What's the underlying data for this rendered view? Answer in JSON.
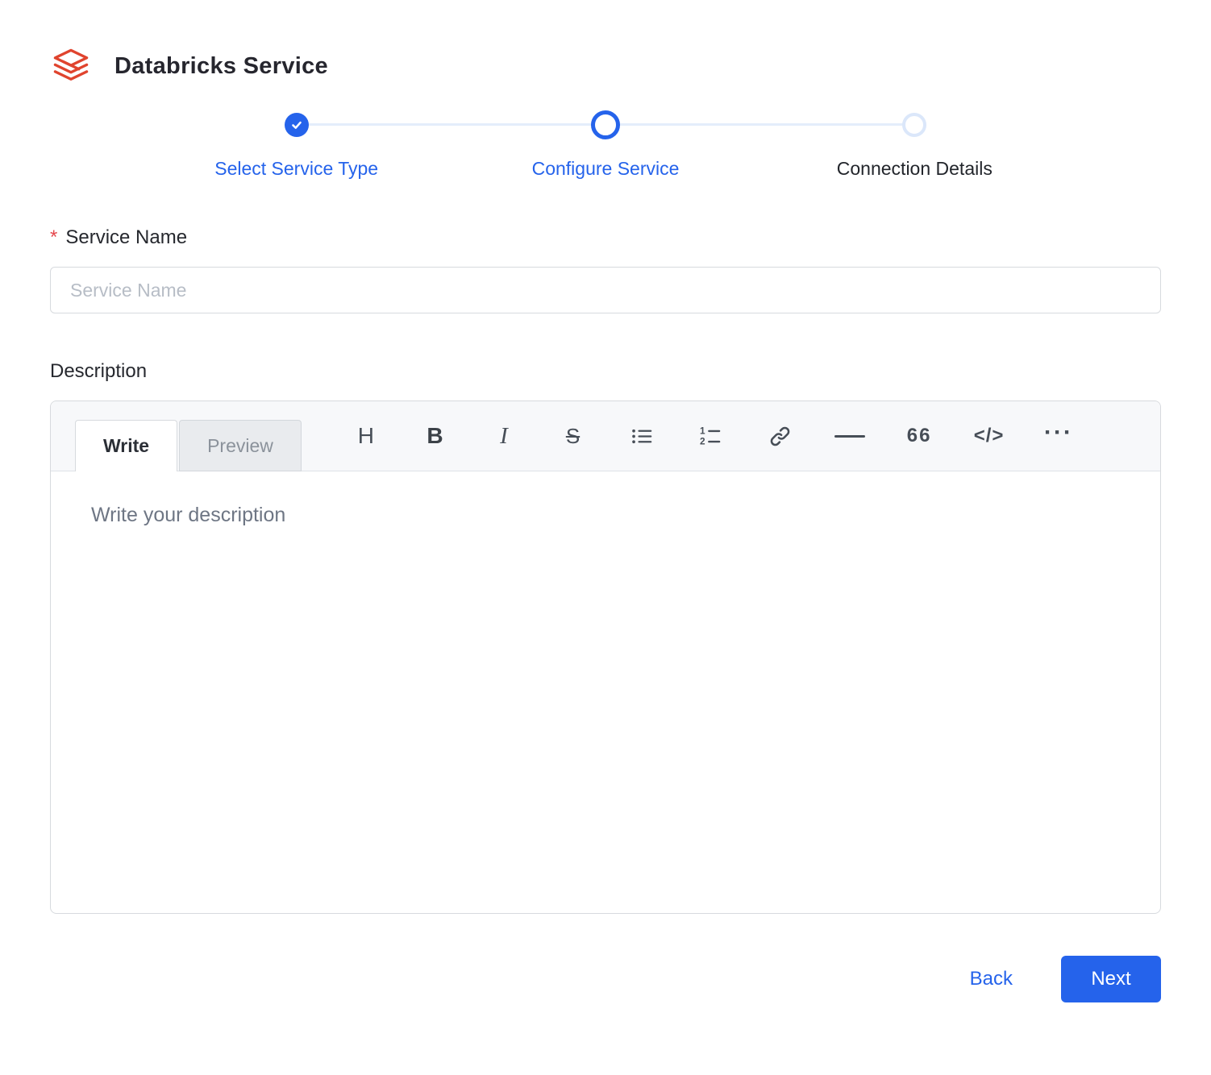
{
  "header": {
    "title": "Databricks Service"
  },
  "stepper": {
    "steps": [
      {
        "label": "Select Service Type",
        "state": "completed"
      },
      {
        "label": "Configure Service",
        "state": "active"
      },
      {
        "label": "Connection Details",
        "state": "pending"
      }
    ]
  },
  "form": {
    "service_name": {
      "label": "Service Name",
      "required_marker": "*",
      "placeholder": "Service Name",
      "value": ""
    },
    "description": {
      "label": "Description",
      "tabs": [
        {
          "label": "Write"
        },
        {
          "label": "Preview"
        }
      ],
      "toolbar": {
        "heading": "H",
        "bold": "B",
        "italic": "I",
        "strikethrough": "S",
        "quote": "66",
        "code": "</>",
        "more": "···"
      },
      "icon_names": [
        "heading-icon",
        "bold-icon",
        "italic-icon",
        "strikethrough-icon",
        "unordered-list-icon",
        "ordered-list-icon",
        "link-icon",
        "horizontal-rule-icon",
        "quote-icon",
        "code-icon",
        "more-icon"
      ],
      "placeholder": "Write your description",
      "value": ""
    }
  },
  "footer": {
    "back_label": "Back",
    "next_label": "Next"
  },
  "colors": {
    "accent": "#2563eb",
    "required": "#e5484d",
    "logo_red": "#e0442e",
    "stepper_line": "#e4edfb"
  }
}
